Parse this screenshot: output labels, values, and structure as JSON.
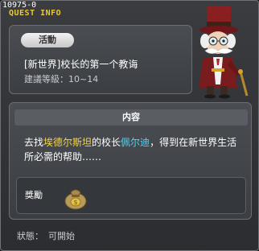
{
  "window": {
    "quest_id": "10975-0",
    "title": "QUEST INFO"
  },
  "quest": {
    "category_badge": "活動",
    "name": "[新世界]校长的第一个教诲",
    "level_requirement": "建議等級：10~14"
  },
  "content": {
    "header": "内容",
    "description": {
      "part1": "去找",
      "location": "埃德尔斯坦",
      "part2": "的校长",
      "npc": "佩尔迪",
      "part3": "，得到在新世界生活所必需的帮助……"
    }
  },
  "reward": {
    "label": "獎勵",
    "icon": "money-bag-icon"
  },
  "status": {
    "label": "狀態：",
    "value": "可開始"
  },
  "colors": {
    "title": "#e8c83a",
    "highlight_location": "#f2d54b",
    "highlight_npc": "#54d4f2"
  }
}
